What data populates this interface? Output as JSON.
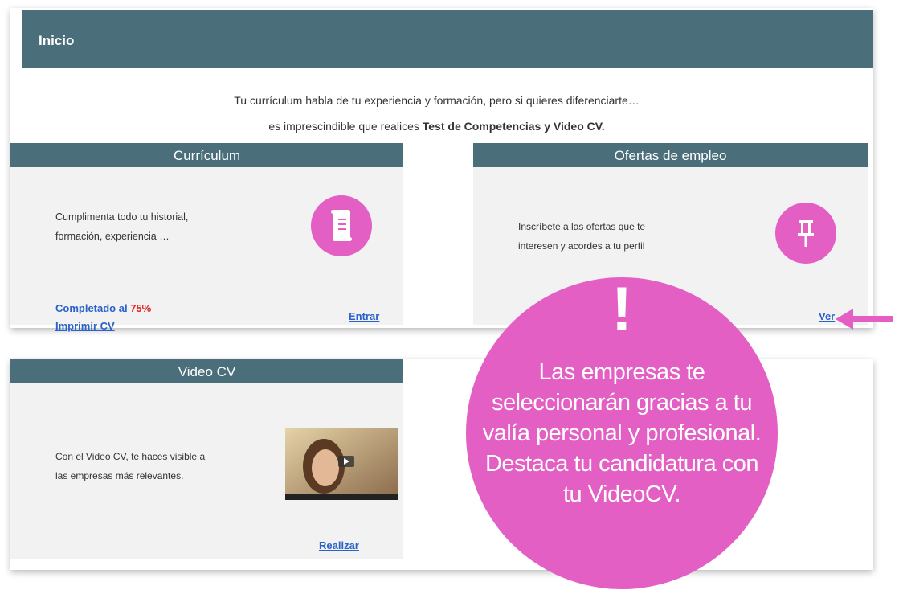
{
  "header": {
    "title": "Inicio"
  },
  "intro": {
    "line1": "Tu currículum habla de tu experiencia y formación, pero si quieres diferenciarte…",
    "line2_prefix": "es imprescindible que realices ",
    "line2_bold": "Test de Competencias y Video CV."
  },
  "curriculum": {
    "title": "Currículum",
    "description_line1": "Cumplimenta todo tu historial,",
    "description_line2": "formación, experiencia …",
    "completed_label": "Completado al ",
    "completed_pct": "75%",
    "print_label": "Imprimir CV",
    "enter_label": "Entrar",
    "icon": "document-scroll-icon"
  },
  "ofertas": {
    "title": "Ofertas de empleo",
    "description_line1": "Inscríbete a las ofertas que te",
    "description_line2": "interesen y acordes a tu perfil",
    "view_label": "Ver",
    "icon": "pushpin-icon"
  },
  "video": {
    "title": "Video CV",
    "description_line1": "Con el Video CV, te haces visible a",
    "description_line2": "las empresas más relevantes.",
    "action_label": "Realizar",
    "icon": "video-play-icon"
  },
  "callout": {
    "mark": "!",
    "text": "Las empresas te seleccionarán gracias a tu valía personal y profesional. Destaca tu candidatura con tu VideoCV."
  },
  "colors": {
    "header": "#4a6f7b",
    "accent": "#e35fc3",
    "link": "#2a62c9",
    "percent": "#e02020"
  }
}
